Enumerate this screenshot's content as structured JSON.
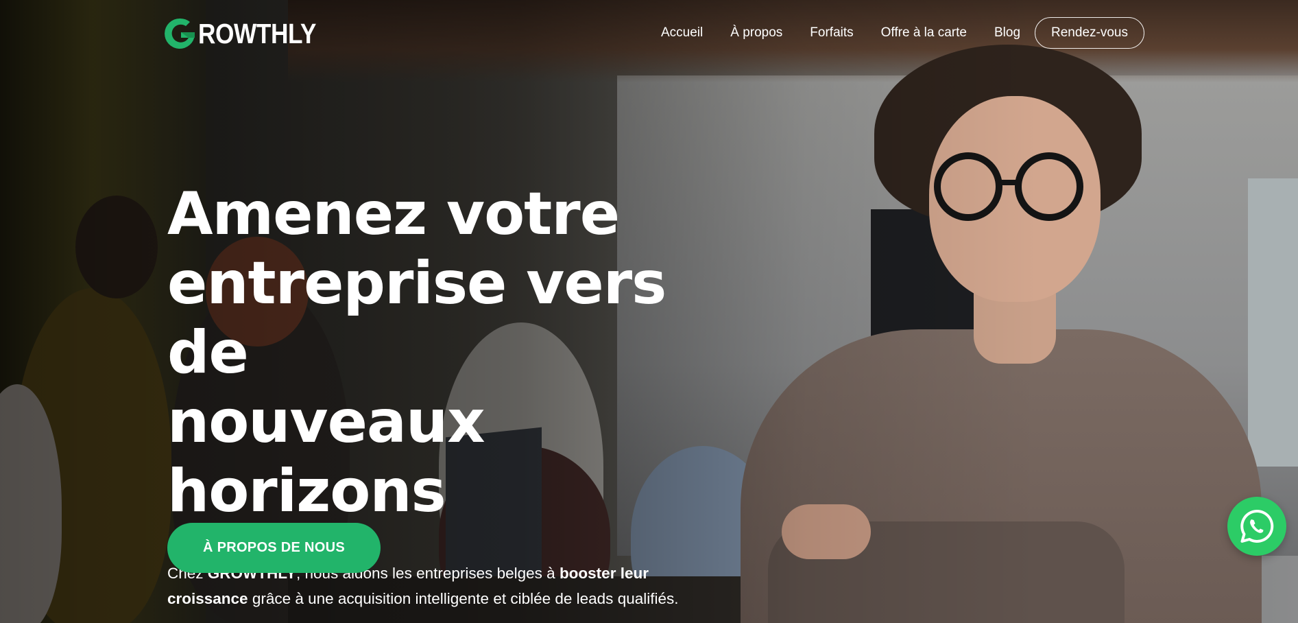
{
  "brand": {
    "name_rest": "ROWTHLY",
    "accent_color": "#22b46a"
  },
  "nav": {
    "items": [
      {
        "label": "Accueil"
      },
      {
        "label": "À propos"
      },
      {
        "label": "Forfaits"
      },
      {
        "label": "Offre à la carte"
      },
      {
        "label": "Blog"
      }
    ],
    "cta_label": "Rendez-vous"
  },
  "hero": {
    "title_line1": "Amenez votre",
    "title_line2": "entreprise vers de",
    "title_line3": "nouveaux horizons",
    "lead_prefix": "Chez ",
    "lead_brand": "GROWTHLY",
    "lead_mid": ", nous aidons les entreprises belges à ",
    "lead_strong": "booster leur croissance",
    "lead_suffix": " grâce à une acquisition intelligente et ciblée de leads qualifiés.",
    "button_label": "À PROPOS DE NOUS"
  },
  "floating": {
    "whatsapp_icon": "whatsapp-icon",
    "whatsapp_color": "#2ccc66"
  }
}
